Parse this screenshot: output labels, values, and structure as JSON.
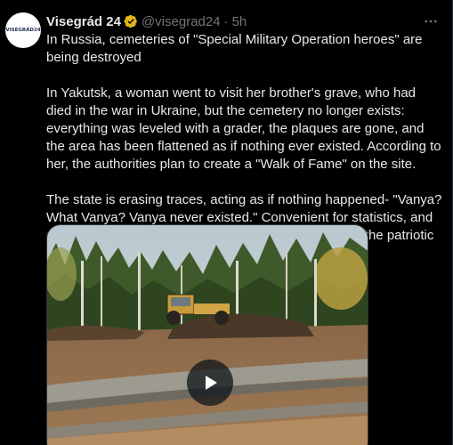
{
  "tweet": {
    "avatar_label": "VISEGRÁD24",
    "display_name": "Visegrád 24",
    "handle": "@visegrad24",
    "separator": "·",
    "time": "5h",
    "paragraphs": [
      "In Russia, cemeteries of \"Special Military Operation heroes\" are being destroyed",
      "In Yakutsk, a woman went to visit her brother's grave, who had died in the war in Ukraine, but the cemetery no longer exists: everything was leveled with a grader, the plaques are gone, and the area has been flattened as if nothing ever existed. According to her, the authorities plan to create a \"Walk of Fame\" on the site.",
      "The state is erasing traces, acting as if nothing happened- \"Vanya? What Vanya? Vanya never existed.\" Convenient for statistics, and so that thousands of graves with tricolors don't offend the patriotic public."
    ],
    "icons": {
      "verified": "verified-badge-icon",
      "more": "more-options-icon",
      "play": "play-icon"
    },
    "colors": {
      "background": "#000000",
      "text": "#e7e9ea",
      "secondary": "#71767b",
      "verified_gold": "#e2b719"
    }
  }
}
